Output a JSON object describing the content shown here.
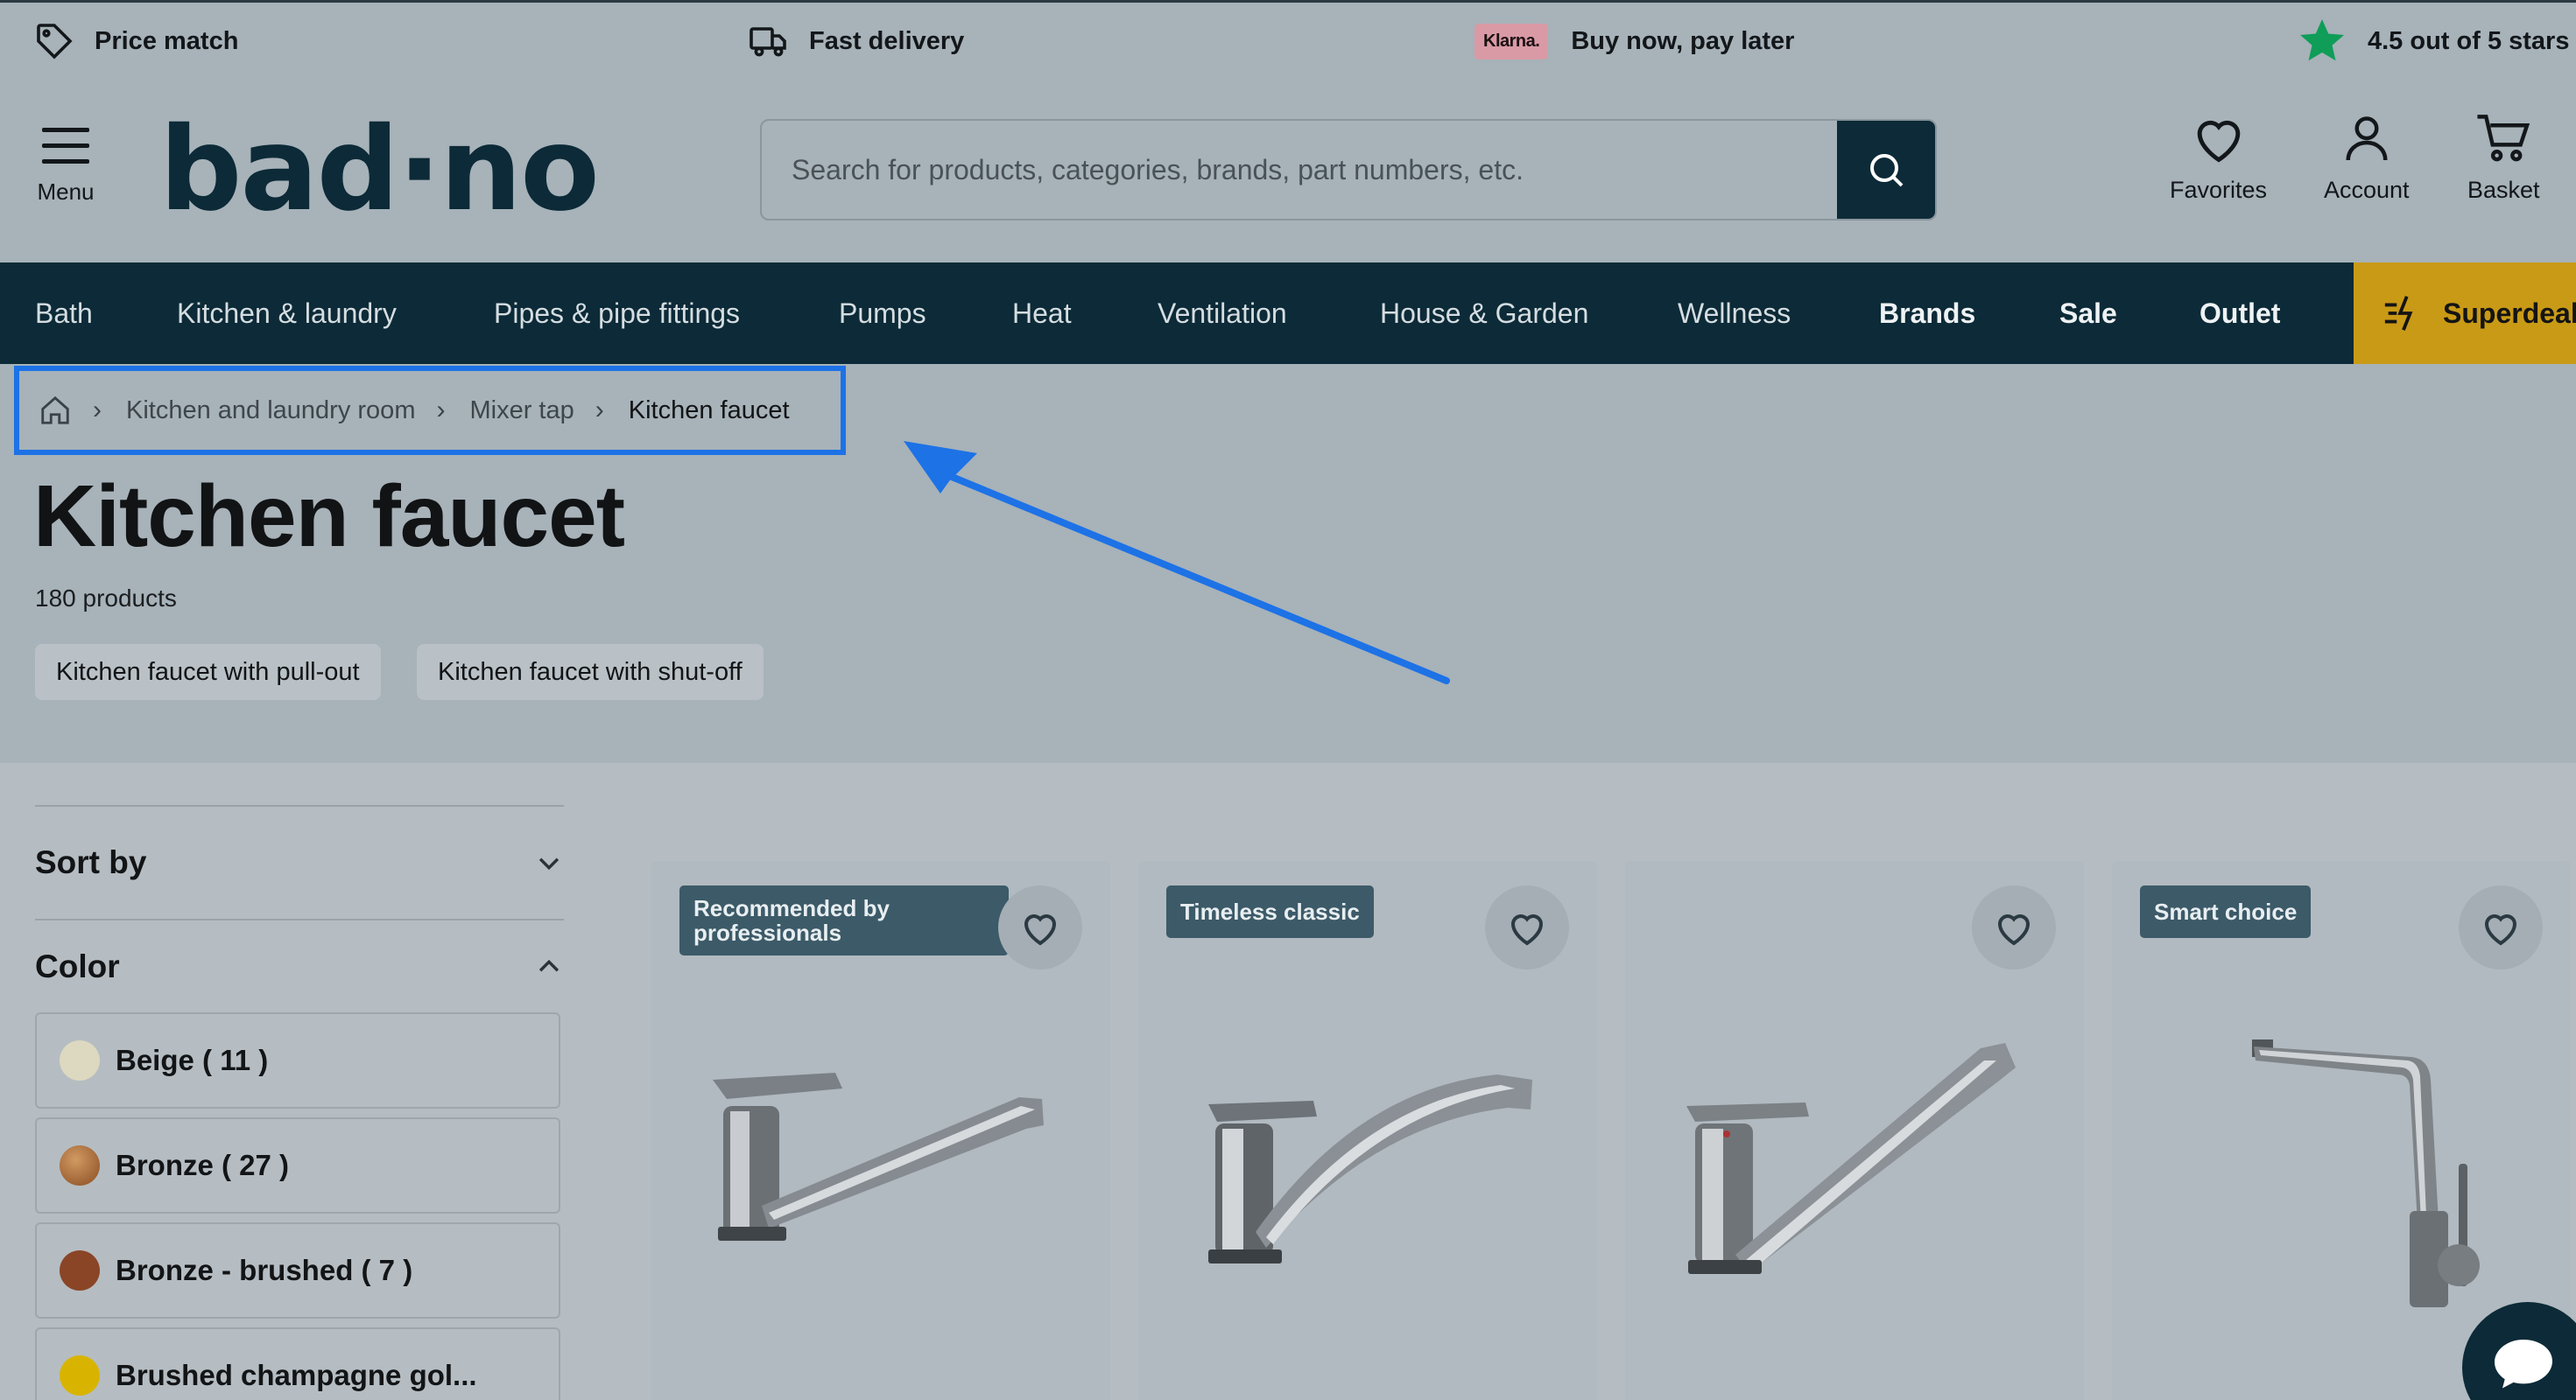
{
  "usp_bar": {
    "price_match": "Price match",
    "fast_delivery": "Fast delivery",
    "klarna_logo": "Klarna.",
    "pay_later": "Buy now, pay later",
    "rating": "4.5 out of 5 stars",
    "star_color": "#0f9d58"
  },
  "header": {
    "menu_label": "Menu",
    "logo": "bad·no",
    "search_placeholder": "Search for products, categories, brands, part numbers, etc.",
    "favorites": "Favorites",
    "account": "Account",
    "basket": "Basket"
  },
  "nav": {
    "items": [
      "Bath",
      "Kitchen & laundry",
      "Pipes & pipe fittings",
      "Pumps",
      "Heat",
      "Ventilation",
      "House & Garden",
      "Wellness",
      "Brands",
      "Sale",
      "Outlet"
    ],
    "superdeal": "Superdeal"
  },
  "breadcrumb": {
    "home_icon": "home-icon",
    "items": [
      "Kitchen and laundry room",
      "Mixer tap",
      "Kitchen faucet"
    ]
  },
  "page": {
    "title": "Kitchen faucet",
    "count": "180 products",
    "chips": [
      "Kitchen faucet with pull-out",
      "Kitchen faucet with shut-off"
    ]
  },
  "filters": {
    "sort_by": "Sort by",
    "color": "Color",
    "colors": [
      {
        "label": "Beige ( 11 )",
        "swatch": "#ddd8c0"
      },
      {
        "label": "Bronze ( 27 )",
        "swatch": "#a8683a"
      },
      {
        "label": "Bronze - brushed ( 7 )",
        "swatch": "#8a4526"
      },
      {
        "label": "Brushed champagne gol...",
        "swatch": "#d8b400"
      }
    ]
  },
  "products": [
    {
      "badge": "Recommended by professionals"
    },
    {
      "badge": "Timeless classic"
    },
    {
      "badge": ""
    },
    {
      "badge": "Smart choice"
    }
  ],
  "accent_colors": {
    "nav_bg": "#0c2a37",
    "superdeal_bg": "#c99a16",
    "highlight": "#1d72e6"
  }
}
